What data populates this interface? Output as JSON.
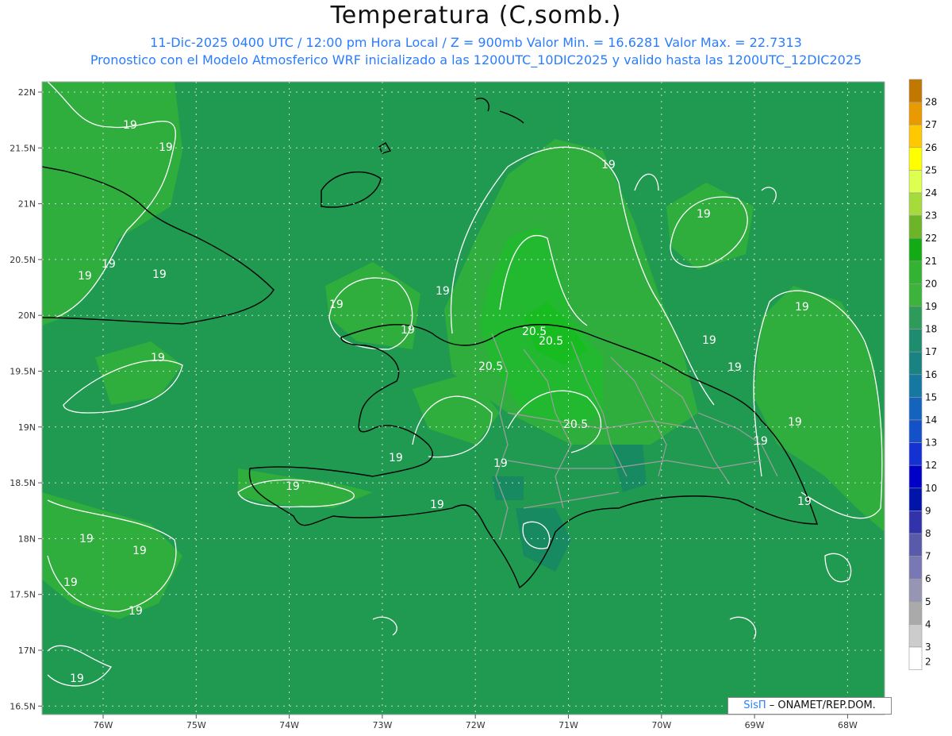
{
  "header": {
    "title": "Temperatura (C,somb.)",
    "line1": "11-Dic-2025  0400 UTC / 12:00 pm Hora Local / Z = 900mb    Valor Min. = 16.6281  Valor Max. = 22.7313",
    "line2": "Pronostico con el Modelo Atmosferico WRF inicializado a las 1200UTC_10DIC2025 y valido hasta las  1200UTC_12DIC2025"
  },
  "axes": {
    "lat_labels": [
      "22N",
      "21.5N",
      "21N",
      "20.5N",
      "20N",
      "19.5N",
      "19N",
      "18.5N",
      "18N",
      "17.5N",
      "17N",
      "16.5N"
    ],
    "lon_labels": [
      "76W",
      "75W",
      "74W",
      "73W",
      "72W",
      "71W",
      "70W",
      "69W",
      "68W"
    ]
  },
  "colorbar": {
    "labels": [
      "28",
      "27",
      "26",
      "25",
      "24",
      "23",
      "22",
      "21",
      "20",
      "19",
      "18",
      "17",
      "16",
      "15",
      "14",
      "13",
      "12",
      "10",
      "9",
      "8",
      "7",
      "6",
      "5",
      "4",
      "3",
      "2"
    ],
    "colors": [
      "#c07800",
      "#e89a00",
      "#ffc800",
      "#ffff00",
      "#dcff50",
      "#a5dc3c",
      "#6eb428",
      "#14aa14",
      "#32b432",
      "#3cb43c",
      "#2d9b5a",
      "#1e8c6e",
      "#198282",
      "#1478a0",
      "#1464be",
      "#1450c8",
      "#1432d2",
      "#0000c8",
      "#0014aa",
      "#3232aa",
      "#5a5aaa",
      "#7878b4",
      "#9696b4",
      "#aaaaaa",
      "#cccccc",
      "#ffffff"
    ]
  },
  "contour_labels": [
    "19",
    "19",
    "19",
    "19",
    "19",
    "19",
    "19",
    "19",
    "19",
    "19",
    "19",
    "19",
    "19",
    "19",
    "19",
    "19",
    "19",
    "19",
    "19",
    "19",
    "19",
    "19",
    "19",
    "19",
    "19",
    "19",
    "20.5",
    "20.5",
    "20.5",
    "20.5"
  ],
  "credit": {
    "brand": "SisΠ",
    "text": "ONAMET/REP.DOM."
  }
}
